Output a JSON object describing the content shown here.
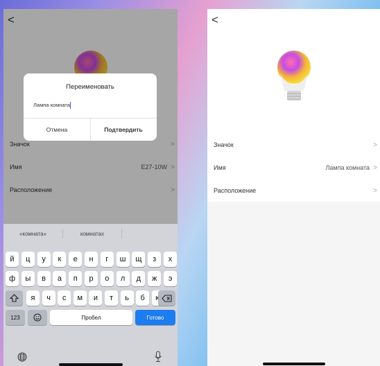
{
  "left_screen": {
    "back_glyph": "<",
    "rows": [
      {
        "label": "Значок",
        "value": ""
      },
      {
        "label": "Имя",
        "value": "E27-10W"
      },
      {
        "label": "Расположение",
        "value": ""
      }
    ],
    "dialog": {
      "title": "Переименовать",
      "input_value": "Лампа комната",
      "cancel": "Отмена",
      "confirm": "Подтвердить"
    },
    "keyboard": {
      "suggestions": [
        "«комната»",
        "комнатах",
        ""
      ],
      "row1": [
        "й",
        "ц",
        "у",
        "к",
        "е",
        "н",
        "г",
        "ш",
        "щ",
        "з",
        "х"
      ],
      "row2": [
        "ф",
        "ы",
        "в",
        "а",
        "п",
        "р",
        "о",
        "л",
        "д",
        "ж",
        "э"
      ],
      "row3": [
        "я",
        "ч",
        "с",
        "м",
        "и",
        "т",
        "ь",
        "б",
        "ю"
      ],
      "numbers_key": "123",
      "space_key": "Пробел",
      "done_key": "Готово"
    }
  },
  "right_screen": {
    "back_glyph": "<",
    "rows": [
      {
        "label": "Значок",
        "value": ""
      },
      {
        "label": "Имя",
        "value": "Лампа комната"
      },
      {
        "label": "Расположение",
        "value": ""
      }
    ]
  },
  "colors": {
    "accent": "#1c7cf0",
    "caret": "#6a40d8"
  }
}
